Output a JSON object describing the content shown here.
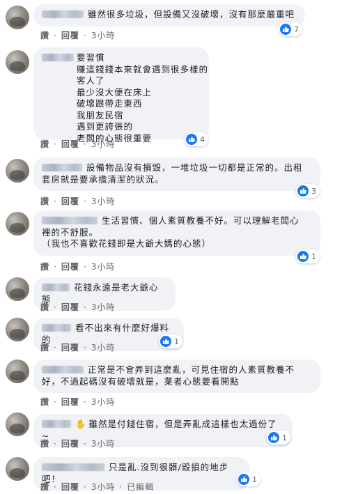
{
  "common": {
    "like_label": "讚",
    "reply_label": "回覆",
    "separator": "·",
    "time": "3小時",
    "edited_label": "已編輯"
  },
  "comments": [
    {
      "text": "雖然很多垃圾，但設備又沒破壞，沒有那麼嚴重吧",
      "likes": "7"
    },
    {
      "text": "要習慣\n賺這錢錢本來就會遇到很多樣的客人了\n最少沒大便在床上\n破壞跟帶走東西\n我朋友民宿\n遇到更誇張的\n老闆的心態很重要",
      "likes": "4"
    },
    {
      "text": "設備物品沒有損毀，一堆垃圾一切都是正常的。出租\n套房就是要承擔清潔的狀況。",
      "likes": "3"
    },
    {
      "text": "生活習慣、個人素質教養不好。可以理解老闆心\n裡的不舒服。\n（我也不喜歡花錢即是大爺大媽的心態）",
      "likes": "1"
    },
    {
      "text": "花錢永遠是老大爺心態",
      "likes": ""
    },
    {
      "text": "看不出來有什麼好爆料的",
      "likes": "1"
    },
    {
      "text": "正常是不會弄到這麼亂，可見住宿的人素質教養不\n好，不過起碼沒有破壞就是，業者心態要看開點",
      "likes": ""
    },
    {
      "text": "雖然是付錢住宿，但是弄亂成這樣也太過份了~",
      "likes": "1",
      "emoji": "✋"
    },
    {
      "text": "只是亂.沒到很髒/毀損的地步吧！",
      "likes": "1"
    }
  ],
  "colors": {
    "bubble": "#f0f2f5",
    "like_blue": "#1877f2",
    "meta_gray": "#65676b"
  },
  "icons": {
    "like": "thumbs-up-icon"
  }
}
